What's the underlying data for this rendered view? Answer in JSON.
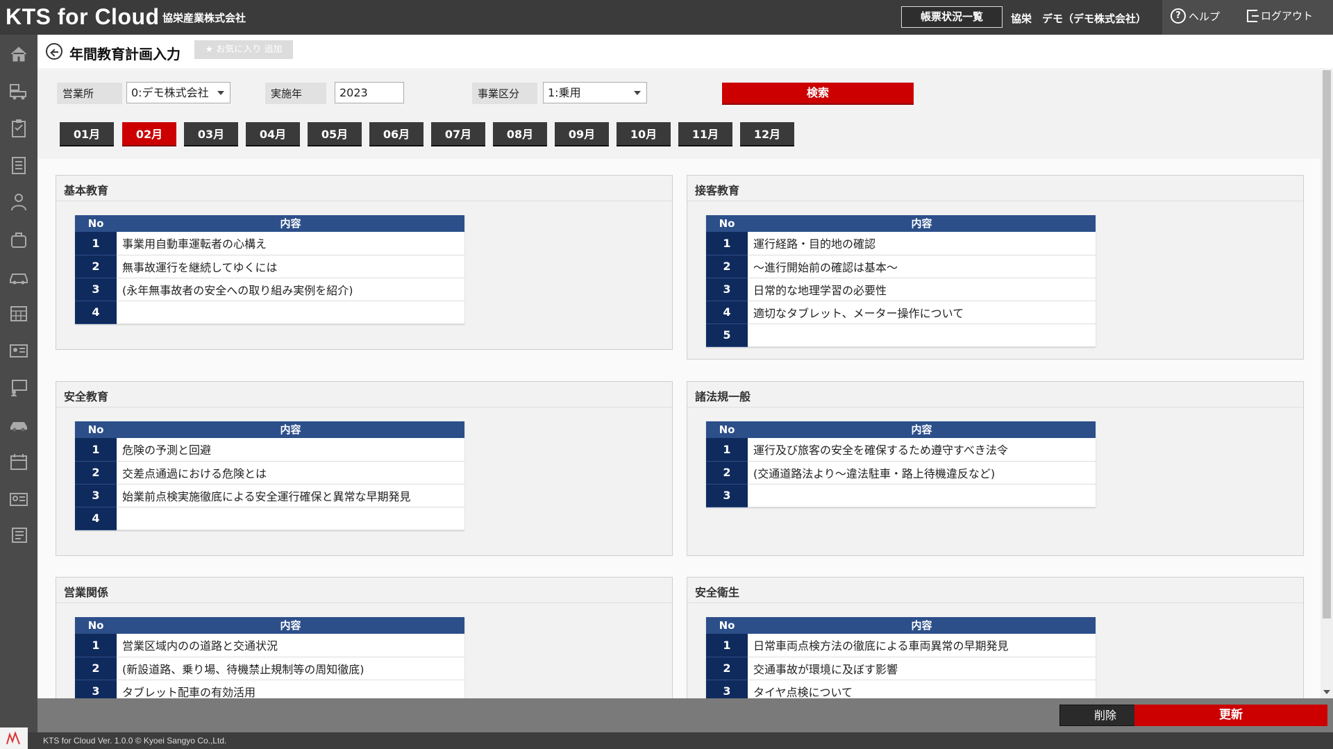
{
  "header": {
    "brand": "KTS for Cloud",
    "company": "協栄産業株式会社",
    "report_button": "帳票状況一覧",
    "user": "協栄　デモ（デモ株式会社）",
    "help": "ヘルプ",
    "logout": "ログアウト"
  },
  "sidebar": {
    "icons": [
      "home-icon",
      "truck-icon",
      "clipboard-icon",
      "document-list-icon",
      "driver-icon",
      "bag-icon",
      "vehicle-icon",
      "calendar-grid-icon",
      "id-card-icon",
      "training-icon",
      "car-icon",
      "schedule-icon",
      "report-icon",
      "tablet-icon"
    ]
  },
  "title": {
    "page_title": "年間教育計画入力",
    "favorite_label": "お気に入り 追加"
  },
  "search": {
    "office_label": "営業所",
    "office_value": "0:デモ株式会社",
    "year_label": "実施年",
    "year_value": "2023",
    "division_label": "事業区分",
    "division_value": "1:乗用",
    "search_button": "検索"
  },
  "months": [
    "01月",
    "02月",
    "03月",
    "04月",
    "05月",
    "06月",
    "07月",
    "08月",
    "09月",
    "10月",
    "11月",
    "12月"
  ],
  "active_month": "02月",
  "table_headers": {
    "no": "No",
    "content": "内容"
  },
  "panels": [
    {
      "title": "基本教育",
      "rows": [
        {
          "no": "1",
          "text": "事業用自動車運転者の心構え"
        },
        {
          "no": "2",
          "text": "無事故運行を継続してゆくには"
        },
        {
          "no": "3",
          "text": "(永年無事故者の安全への取り組み実例を紹介)"
        },
        {
          "no": "4",
          "text": ""
        }
      ]
    },
    {
      "title": "接客教育",
      "rows": [
        {
          "no": "1",
          "text": "運行経路・目的地の確認"
        },
        {
          "no": "2",
          "text": "～進行開始前の確認は基本～"
        },
        {
          "no": "3",
          "text": "日常的な地理学習の必要性"
        },
        {
          "no": "4",
          "text": "適切なタブレット、メーター操作について"
        },
        {
          "no": "5",
          "text": ""
        }
      ]
    },
    {
      "title": "安全教育",
      "rows": [
        {
          "no": "1",
          "text": "危険の予測と回避"
        },
        {
          "no": "2",
          "text": "交差点通過における危険とは"
        },
        {
          "no": "3",
          "text": "始業前点検実施徹底による安全運行確保と異常な早期発見"
        },
        {
          "no": "4",
          "text": ""
        }
      ]
    },
    {
      "title": "諸法規一般",
      "rows": [
        {
          "no": "1",
          "text": "運行及び旅客の安全を確保するため遵守すべき法令"
        },
        {
          "no": "2",
          "text": "(交通道路法より～違法駐車・路上待機違反など)"
        },
        {
          "no": "3",
          "text": ""
        }
      ]
    },
    {
      "title": "営業関係",
      "rows": [
        {
          "no": "1",
          "text": "営業区域内のの道路と交通状況"
        },
        {
          "no": "2",
          "text": "(新設道路、乗り場、待機禁止規制等の周知徹底)"
        },
        {
          "no": "3",
          "text": "タブレット配車の有効活用"
        }
      ]
    },
    {
      "title": "安全衛生",
      "rows": [
        {
          "no": "1",
          "text": "日常車両点検方法の徹底による車両異常の早期発見"
        },
        {
          "no": "2",
          "text": "交通事故が環境に及ぼす影響"
        },
        {
          "no": "3",
          "text": "タイヤ点検について"
        }
      ]
    }
  ],
  "actions": {
    "delete": "削除",
    "update": "更新"
  },
  "footer": "KTS for Cloud Ver. 1.0.0 © Kyoei Sangyo Co.,Ltd.",
  "colors": {
    "accent_red": "#cc0000",
    "table_header": "#2c4f8a",
    "no_cell": "#0f2a5c",
    "topbar": "#3b3b3b"
  }
}
